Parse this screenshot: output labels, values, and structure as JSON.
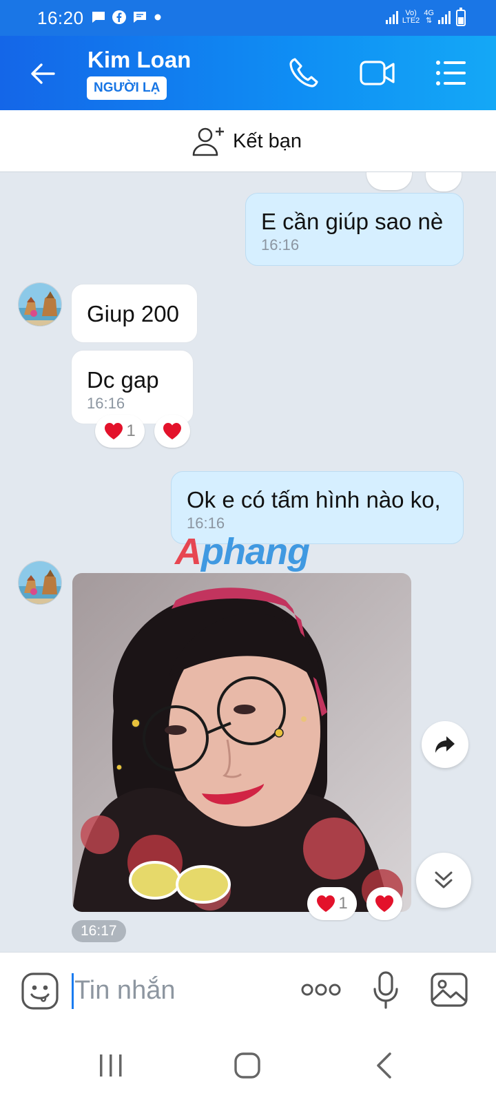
{
  "status_bar": {
    "time": "16:20",
    "network_labels": [
      "Vo)",
      "LTE2"
    ],
    "network_type": "4G",
    "icons": [
      "message-icon",
      "facebook-icon",
      "chat-icon",
      "dot-icon",
      "signal-icon",
      "battery-icon"
    ]
  },
  "header": {
    "contact_name": "Kim Loan",
    "badge": "NGƯỜI LẠ",
    "icons": [
      "back-arrow-icon",
      "phone-icon",
      "video-call-icon",
      "menu-icon"
    ]
  },
  "add_friend": {
    "label": "Kết bạn",
    "icon": "add-person-icon"
  },
  "messages": [
    {
      "direction": "outgoing",
      "text": "E cần giúp sao nè",
      "time": "16:16"
    },
    {
      "direction": "incoming",
      "text": "Giup 200"
    },
    {
      "direction": "incoming",
      "text": "Dc gap",
      "time": "16:16",
      "reaction_count": "1"
    },
    {
      "direction": "outgoing",
      "text": "Ok e có tấm hình nào ko,",
      "time": "16:16"
    },
    {
      "direction": "incoming",
      "type": "photo",
      "time": "16:17",
      "reaction_count": "1"
    }
  ],
  "watermark": {
    "part1": "A",
    "part2": "phang"
  },
  "composer": {
    "placeholder": "Tin nhắn",
    "icons": [
      "emoji-icon",
      "more-icon",
      "microphone-icon",
      "image-icon"
    ]
  },
  "navbar": {
    "icons": [
      "recent-apps-icon",
      "home-icon",
      "back-icon"
    ]
  },
  "colors": {
    "header_blue": "#1466e8",
    "outgoing_bubble": "#d6efff",
    "incoming_bubble": "#ffffff",
    "chat_background": "#e2e8ef",
    "heart_red": "#e3122b"
  }
}
